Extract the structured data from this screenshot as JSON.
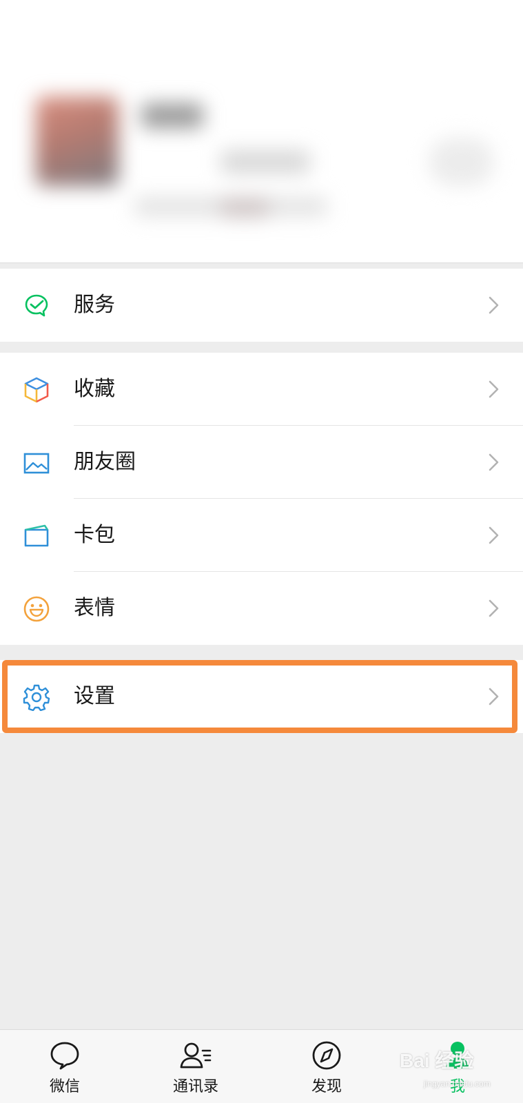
{
  "colors": {
    "accent_green": "#07c160",
    "highlight_orange": "#f5893b",
    "background": "#ededed"
  },
  "menu": {
    "group1": [
      {
        "label": "服务",
        "icon": "wechat-pay-check-icon"
      }
    ],
    "group2": [
      {
        "label": "收藏",
        "icon": "favorites-cube-icon"
      },
      {
        "label": "朋友圈",
        "icon": "moments-image-icon"
      },
      {
        "label": "卡包",
        "icon": "card-wallet-icon"
      },
      {
        "label": "表情",
        "icon": "smiley-face-icon"
      }
    ],
    "group3": [
      {
        "label": "设置",
        "icon": "gear-icon"
      }
    ]
  },
  "tabbar": {
    "tabs": [
      {
        "label": "微信",
        "icon": "chat-bubble-icon",
        "active": false
      },
      {
        "label": "通讯录",
        "icon": "contacts-icon",
        "active": false
      },
      {
        "label": "发现",
        "icon": "compass-icon",
        "active": false
      },
      {
        "label": "我",
        "icon": "person-icon",
        "active": true
      }
    ]
  },
  "watermark": {
    "text": "Bai 经验",
    "sub": "jingyan.baidu.com"
  }
}
